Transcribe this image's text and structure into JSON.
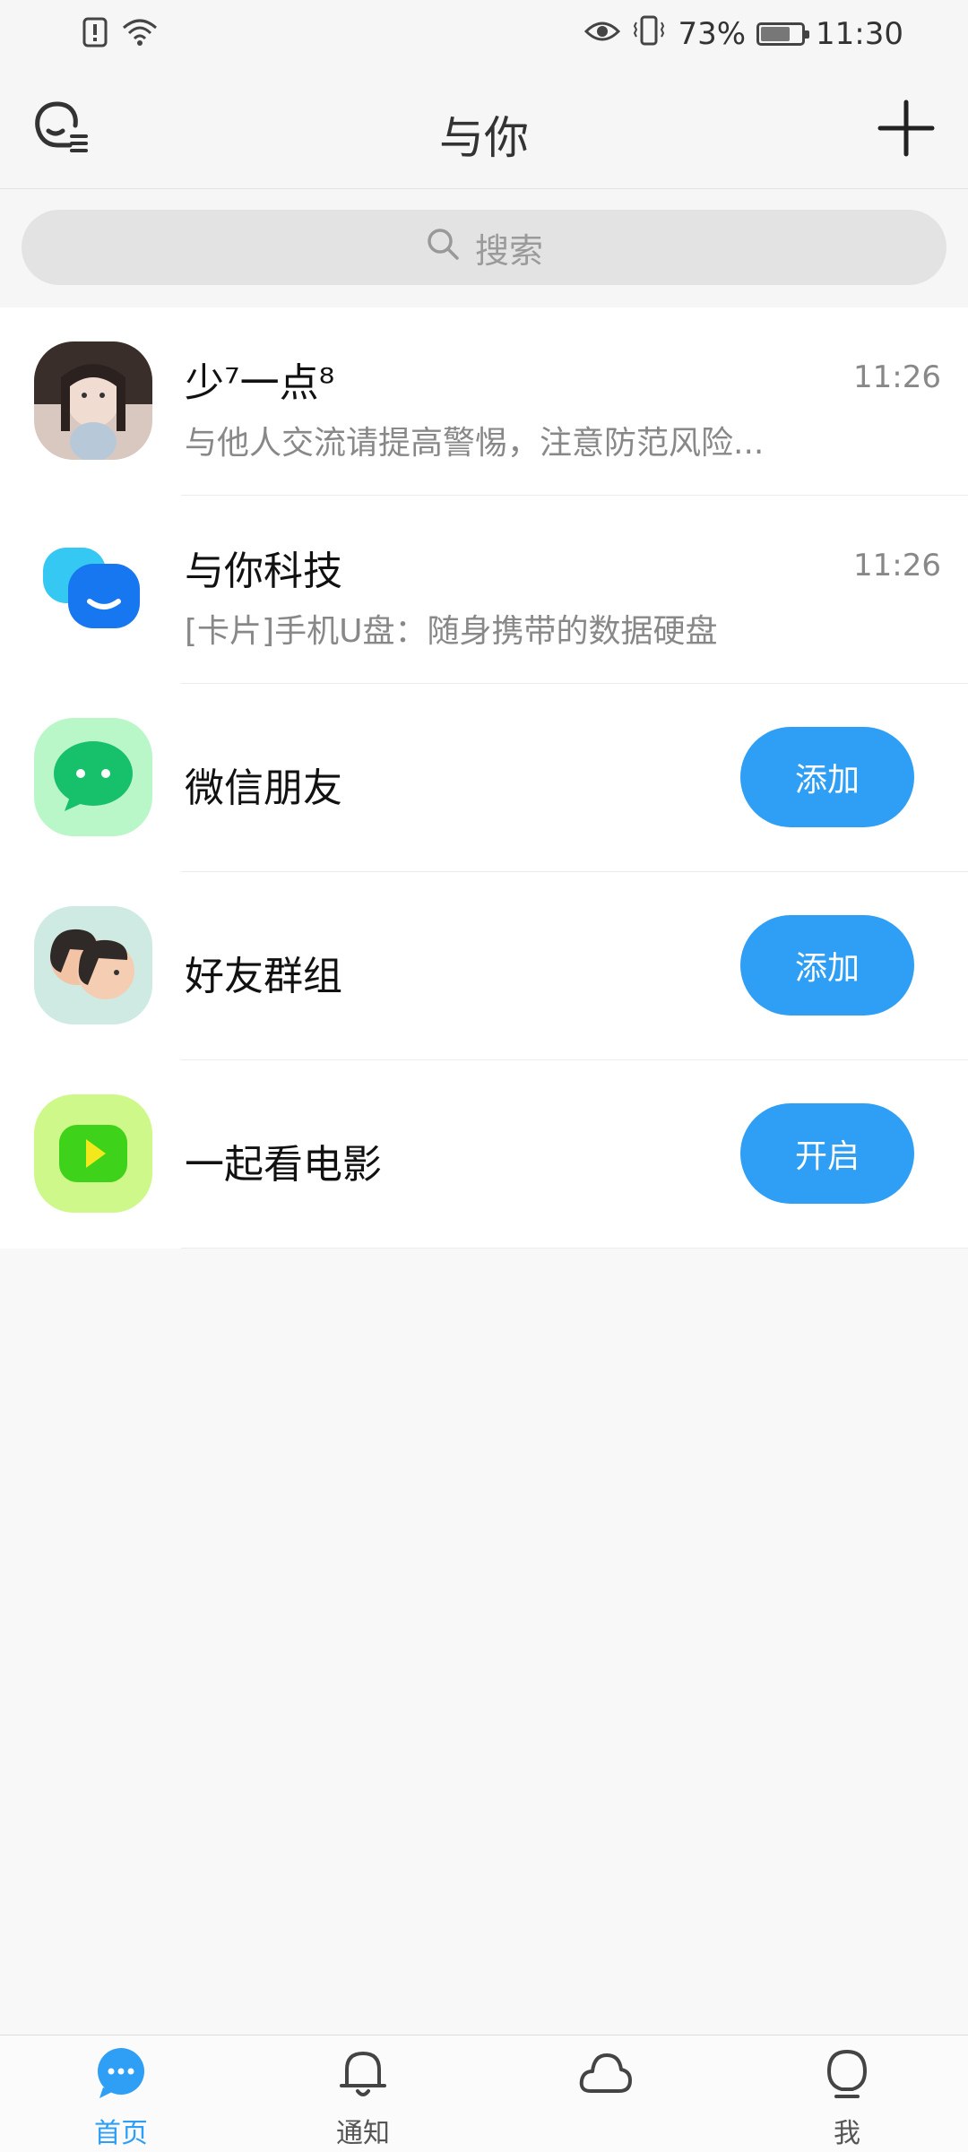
{
  "status_bar": {
    "battery": "73%",
    "time": "11:30",
    "battery_level": 0.73
  },
  "header": {
    "title": "与你"
  },
  "search": {
    "placeholder": "搜索"
  },
  "conversations": [
    {
      "name": "少⁷一点⁸",
      "time": "11:26",
      "preview": "与他人交流请提高警惕，注意防范风险..."
    },
    {
      "name": "与你科技",
      "time": "11:26",
      "preview": "[卡片]手机U盘：随身携带的数据硬盘"
    }
  ],
  "features": [
    {
      "name": "微信朋友",
      "button": "添加",
      "icon": "wechat-icon"
    },
    {
      "name": "好友群组",
      "button": "添加",
      "icon": "group-icon"
    },
    {
      "name": "一起看电影",
      "button": "开启",
      "icon": "video-play-icon"
    }
  ],
  "bottom_nav": [
    {
      "label": "首页",
      "icon": "chat-bubble-icon",
      "active": true
    },
    {
      "label": "通知",
      "icon": "bell-icon",
      "active": false
    },
    {
      "label": "",
      "icon": "cloud-icon",
      "active": false
    },
    {
      "label": "我",
      "icon": "profile-icon",
      "active": false
    }
  ],
  "colors": {
    "accent": "#2f9ff5",
    "background": "#f8f8f8"
  }
}
